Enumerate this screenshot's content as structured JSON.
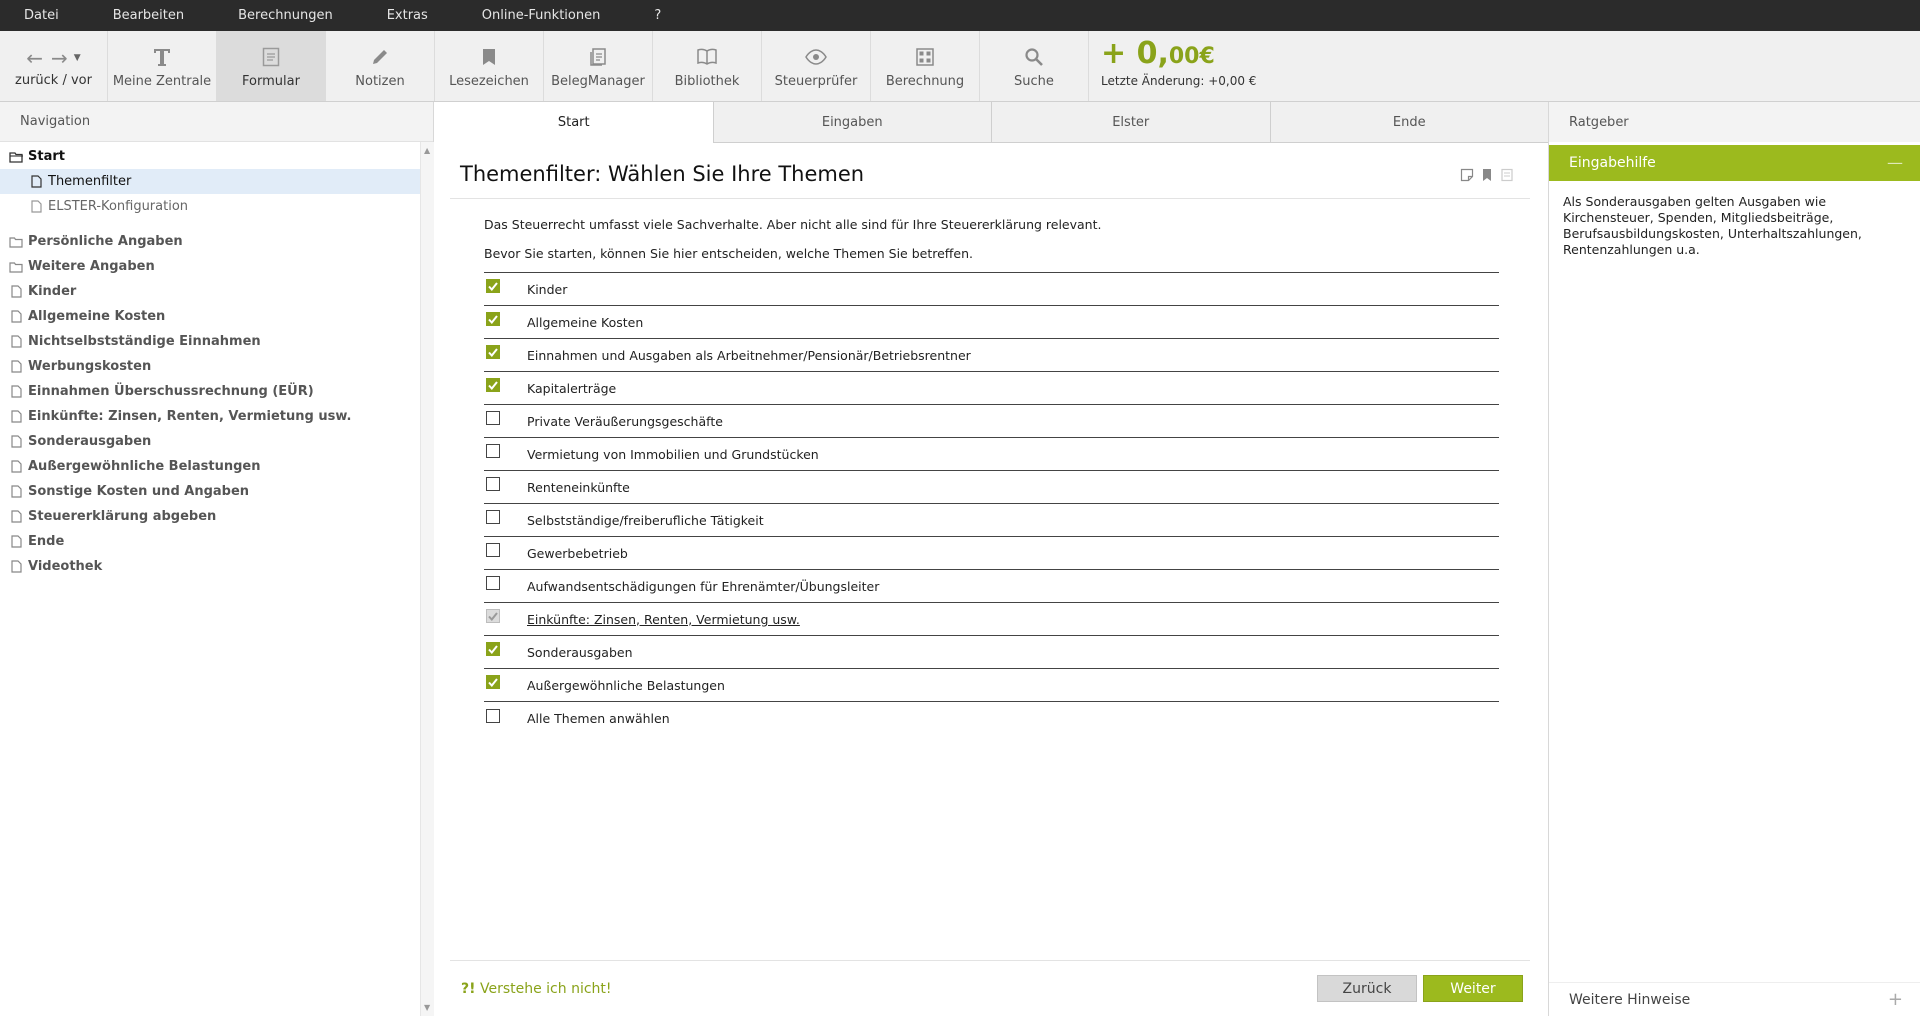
{
  "menu": [
    "Datei",
    "Bearbeiten",
    "Berechnungen",
    "Extras",
    "Online-Funktionen",
    "?"
  ],
  "toolbar": {
    "back_label": "zurück / vor",
    "buttons": [
      {
        "label": "Meine Zentrale",
        "icon": "text-t-icon"
      },
      {
        "label": "Formular",
        "icon": "form-icon"
      },
      {
        "label": "Notizen",
        "icon": "pencil-icon"
      },
      {
        "label": "Lesezeichen",
        "icon": "bookmark-icon"
      },
      {
        "label": "BelegManager",
        "icon": "documents-icon"
      },
      {
        "label": "Bibliothek",
        "icon": "book-icon"
      },
      {
        "label": "Steuerprüfer",
        "icon": "eye-icon"
      },
      {
        "label": "Berechnung",
        "icon": "calculator-icon"
      },
      {
        "label": "Suche",
        "icon": "search-icon"
      }
    ],
    "amount_main": "+ 0,",
    "amount_cents": "00€",
    "last_change": "Letzte Änderung: +0,00 €"
  },
  "navigation": {
    "header": "Navigation",
    "root": "Start",
    "root_children": [
      "Themenfilter",
      "ELSTER-Konfiguration"
    ],
    "items": [
      "Persönliche Angaben",
      "Weitere Angaben",
      "Kinder",
      "Allgemeine Kosten",
      "Nichtselbstständige Einnahmen",
      "Werbungskosten",
      "Einnahmen Überschussrechnung (EÜR)",
      "Einkünfte: Zinsen, Renten, Vermietung usw.",
      "Sonderausgaben",
      "Außergewöhnliche Belastungen",
      "Sonstige Kosten und Angaben",
      "Steuererklärung abgeben",
      "Ende",
      "Videothek"
    ]
  },
  "main": {
    "tabs": [
      "Start",
      "Eingaben",
      "Elster",
      "Ende"
    ],
    "title": "Themenfilter: Wählen Sie Ihre Themen",
    "intro1": "Das Steuerrecht umfasst viele Sachverhalte. Aber nicht alle sind für Ihre Steuererklärung relevant.",
    "intro2": "Bevor Sie starten, können Sie hier entscheiden, welche Themen Sie betreffen.",
    "topics": [
      {
        "label": "Kinder",
        "checked": true
      },
      {
        "label": "Allgemeine Kosten",
        "checked": true
      },
      {
        "label": "Einnahmen und Ausgaben als Arbeitnehmer/Pensionär/Betriebsrentner",
        "checked": true
      },
      {
        "label": "Kapitalerträge",
        "checked": true
      },
      {
        "label": "Private Veräußerungsgeschäfte",
        "checked": false
      },
      {
        "label": "Vermietung von Immobilien und Grundstücken",
        "checked": false
      },
      {
        "label": "Renteneinkünfte",
        "checked": false
      },
      {
        "label": "Selbstständige/freiberufliche Tätigkeit",
        "checked": false
      },
      {
        "label": "Gewerbebetrieb",
        "checked": false
      },
      {
        "label": "Aufwandsentschädigungen für Ehrenämter/Übungsleiter",
        "checked": false
      },
      {
        "label": "Einkünfte: Zinsen, Renten, Vermietung usw.",
        "checked": true,
        "disabled": true,
        "link": true
      },
      {
        "label": "Sonderausgaben",
        "checked": true
      },
      {
        "label": "Außergewöhnliche Belastungen",
        "checked": true
      },
      {
        "label": "Alle Themen anwählen",
        "checked": false
      }
    ],
    "help_mark": "?!",
    "help_text": "Verstehe ich nicht!",
    "back_button": "Zurück",
    "next_button": "Weiter"
  },
  "ratgeber": {
    "header": "Ratgeber",
    "section": "Eingabehilfe",
    "minimize": "—",
    "text": "Als Sonderausgaben gelten Ausgaben wie Kirchensteuer, Spenden, Mitgliedsbeiträge, Berufsausbildungskosten, Unterhaltszahlungen, Rentenzahlungen u.a.",
    "footer": "Weitere Hinweise",
    "footer_plus": "+"
  },
  "colors": {
    "accent": "#9cba1e",
    "accent_text": "#8aa31a",
    "menubar": "#2b2b2b"
  }
}
